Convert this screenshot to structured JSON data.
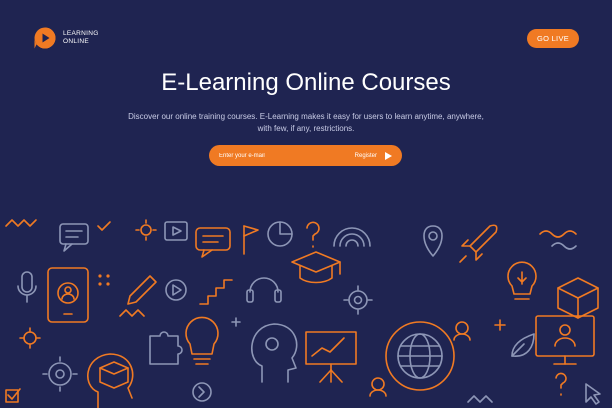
{
  "header": {
    "logo_line1": "LEARNING",
    "logo_line2": "ONLINE",
    "go_live_label": "GO LIVE"
  },
  "hero": {
    "title": "E-Learning Online Courses",
    "description": "Discover our online training courses. E-Learning makes it easy for users to learn anytime, anywhere, with few, if any, restrictions."
  },
  "signup": {
    "email_placeholder": "Enter your e-mail",
    "register_label": "Register"
  },
  "colors": {
    "background": "#1f2451",
    "accent": "#f07a23",
    "line_art_secondary": "#8d96b6"
  },
  "icons": [
    "play-logo-icon",
    "speech-bubble-icon",
    "tablet-icon",
    "microphone-icon",
    "pencil-icon",
    "lightbulb-icon",
    "head-icon",
    "open-box-icon",
    "gear-icon",
    "headphones-icon",
    "graduation-cap-icon",
    "wifi-icon",
    "location-pin-icon",
    "rocket-icon",
    "globe-icon",
    "presentation-board-icon",
    "monitor-icon",
    "pie-chart-icon",
    "puzzle-icon",
    "question-mark-icon",
    "magnifier-icon",
    "trophy-icon",
    "checkmark-icon",
    "certificate-icon",
    "envelope-icon"
  ]
}
